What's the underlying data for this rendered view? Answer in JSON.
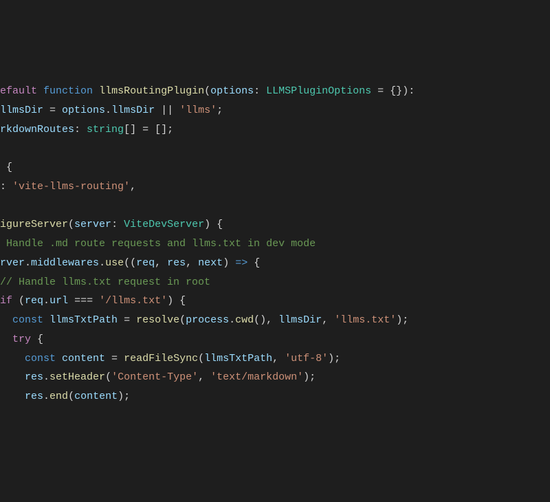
{
  "code": {
    "l1": {
      "kw1": "efault",
      "kw2": "function",
      "fnname": "llmsRoutingPlugin",
      "paren1": "(",
      "param": "options",
      "colon": ": ",
      "type": "LLMSPluginOptions",
      "eq": " = {}",
      "paren2": "):"
    },
    "l2": {
      "var": "llmsDir",
      "eq": " = ",
      "obj": "options",
      "dot": ".",
      "prop": "llmsDir",
      "or": " || ",
      "str": "'llms'",
      "semi": ";"
    },
    "l3": {
      "var": "rkdownRoutes",
      "colon": ": ",
      "type": "string",
      "arr": "[] = []",
      "semi": ";"
    },
    "l4": {
      "brace": " {"
    },
    "l5": {
      "colon": ": ",
      "str": "'vite-llms-routing'",
      "comma": ","
    },
    "l6": {
      "fn": "igureServer",
      "paren1": "(",
      "param": "server",
      "colon": ": ",
      "type": "ViteDevServer",
      "paren2": ") {"
    },
    "l7": {
      "comment": " Handle .md route requests and llms.txt in dev mode"
    },
    "l8": {
      "obj": "rver",
      "dot1": ".",
      "prop1": "middlewares",
      "dot2": ".",
      "fn": "use",
      "paren1": "((",
      "p1": "req",
      "c1": ", ",
      "p2": "res",
      "c2": ", ",
      "p3": "next",
      "paren2": ") ",
      "arrow": "=>",
      "brace": " {"
    },
    "l9": {
      "comment": "// Handle llms.txt request in root"
    },
    "l10": {
      "kw": "if",
      "paren1": " (",
      "obj": "req",
      "dot": ".",
      "prop": "url",
      "eq": " === ",
      "str": "'/llms.txt'",
      "paren2": ") {"
    },
    "l11": {
      "kw": "const",
      "var": " llmsTxtPath",
      "eq": " = ",
      "fn": "resolve",
      "paren1": "(",
      "obj": "process",
      "dot": ".",
      "fn2": "cwd",
      "paren2": "(), ",
      "v2": "llmsDir",
      "c": ", ",
      "str": "'llms.txt'",
      "paren3": ");"
    },
    "l12": {
      "kw": "try",
      "brace": " {"
    },
    "l13": {
      "kw": "const",
      "var": " content",
      "eq": " = ",
      "fn": "readFileSync",
      "paren1": "(",
      "v": "llmsTxtPath",
      "c": ", ",
      "str": "'utf-8'",
      "paren2": ");"
    },
    "l14": {
      "obj": "res",
      "dot": ".",
      "fn": "setHeader",
      "paren1": "(",
      "str1": "'Content-Type'",
      "c": ", ",
      "str2": "'text/markdown'",
      "paren2": ");"
    },
    "l15": {
      "obj": "res",
      "dot": ".",
      "fn": "end",
      "paren1": "(",
      "v": "content",
      "paren2": ");"
    }
  }
}
